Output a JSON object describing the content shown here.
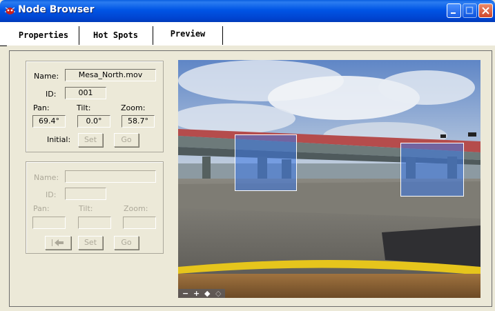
{
  "window": {
    "title": "Node Browser"
  },
  "tabs": [
    {
      "label": "Properties"
    },
    {
      "label": "Hot Spots"
    },
    {
      "label": "Preview"
    }
  ],
  "node_group": {
    "name_label": "Name:",
    "name_value": "Mesa_North.mov",
    "id_label": "ID:",
    "id_value": "001",
    "pan_label": "Pan:",
    "pan_value": "69.4°",
    "tilt_label": "Tilt:",
    "tilt_value": "0.0°",
    "zoom_label": "Zoom:",
    "zoom_value": "58.7°",
    "initial_label": "Initial:",
    "set_label": "Set",
    "go_label": "Go"
  },
  "hotspot_group": {
    "name_label": "Name:",
    "name_value": "",
    "id_label": "ID:",
    "id_value": "",
    "pan_label": "Pan:",
    "pan_value": "",
    "tilt_label": "Tilt:",
    "tilt_value": "",
    "zoom_label": "Zoom:",
    "zoom_value": "",
    "set_label": "Set",
    "go_label": "Go"
  },
  "preview": {
    "controls": [
      "zoom-out",
      "zoom-in",
      "show-hotspots",
      "back"
    ],
    "hotspot_color": "#3c78e6"
  },
  "colors": {
    "titlebar": "#0055e5",
    "face": "#ece9d8",
    "disabled_text": "#aca899"
  }
}
